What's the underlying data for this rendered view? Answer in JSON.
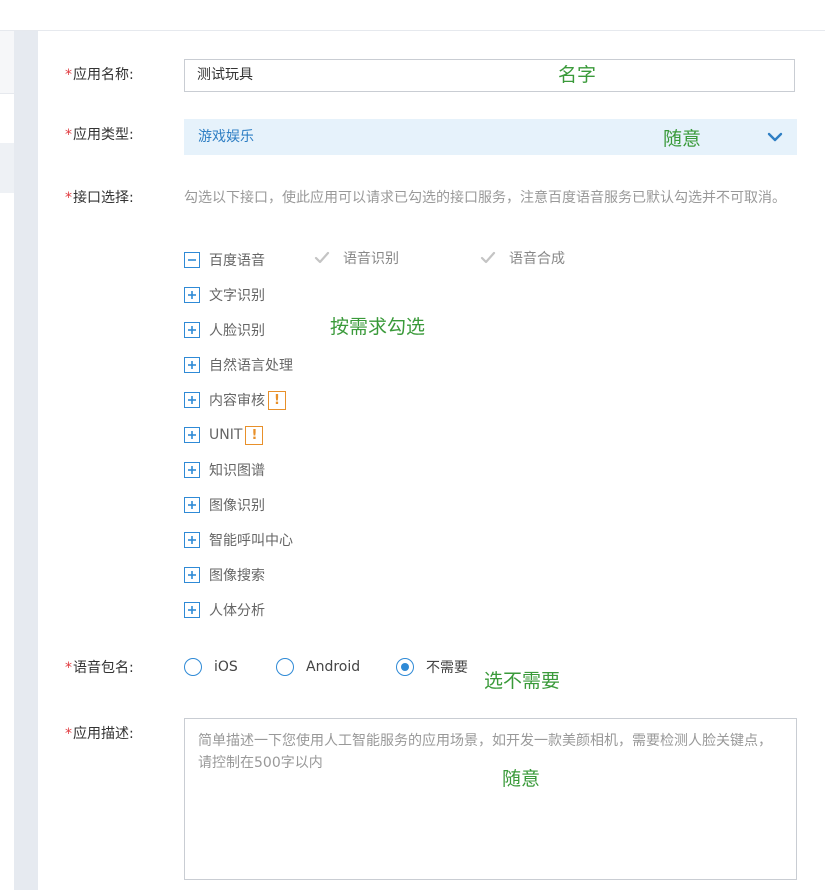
{
  "form": {
    "required_mark": "*",
    "name": {
      "label": "应用名称:",
      "value": "测试玩具"
    },
    "type": {
      "label": "应用类型:",
      "value": "游戏娱乐"
    },
    "api": {
      "label": "接口选择:",
      "hint": "勾选以下接口，使此应用可以请求已勾选的接口服务，注意百度语音服务已默认勾选并不可取消。",
      "groups": [
        {
          "label": "百度语音",
          "expanded": true,
          "children": [
            {
              "label": "语音识别",
              "checked": true,
              "disabled": true
            },
            {
              "label": "语音合成",
              "checked": true,
              "disabled": true
            }
          ]
        },
        {
          "label": "文字识别",
          "expanded": false
        },
        {
          "label": "人脸识别",
          "expanded": false
        },
        {
          "label": "自然语言处理",
          "expanded": false
        },
        {
          "label": "内容审核",
          "expanded": false,
          "warning": "!"
        },
        {
          "label": "UNIT",
          "expanded": false,
          "warning": "!"
        },
        {
          "label": "知识图谱",
          "expanded": false
        },
        {
          "label": "图像识别",
          "expanded": false
        },
        {
          "label": "智能呼叫中心",
          "expanded": false
        },
        {
          "label": "图像搜索",
          "expanded": false
        },
        {
          "label": "人体分析",
          "expanded": false
        }
      ]
    },
    "package": {
      "label": "语音包名:",
      "options": [
        {
          "label": "iOS",
          "selected": false
        },
        {
          "label": "Android",
          "selected": false
        },
        {
          "label": "不需要",
          "selected": true
        }
      ]
    },
    "description": {
      "label": "应用描述:",
      "placeholder": "简单描述一下您使用人工智能服务的应用场景，如开发一款美颜相机，需要检测人脸关键点，请控制在500字以内"
    }
  },
  "annotations": {
    "name": "名字",
    "type": "随意",
    "api": "按需求勾选",
    "package": "选不需要",
    "description": "随意"
  },
  "colors": {
    "accent": "#2f8ad6",
    "required": "#e0393e",
    "warning": "#e8902a",
    "annotation": "#3a9a3a",
    "select_bg": "#e6f2fb"
  }
}
